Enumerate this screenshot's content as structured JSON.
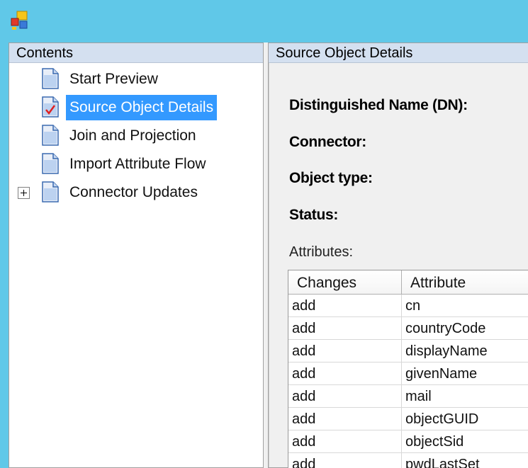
{
  "window": {
    "icon": "app-icon"
  },
  "contents_pane": {
    "header": "Contents",
    "items": [
      {
        "label": "Start Preview",
        "icon": "document-icon",
        "selected": false,
        "expandable": false
      },
      {
        "label": "Source Object Details",
        "icon": "document-check-icon",
        "selected": true,
        "expandable": false
      },
      {
        "label": "Join and Projection",
        "icon": "document-icon",
        "selected": false,
        "expandable": false
      },
      {
        "label": "Import Attribute Flow",
        "icon": "document-icon",
        "selected": false,
        "expandable": false
      },
      {
        "label": "Connector Updates",
        "icon": "document-icon",
        "selected": false,
        "expandable": true
      }
    ]
  },
  "details_pane": {
    "header": "Source Object Details",
    "dn_label": "Distinguished Name (DN):",
    "connector_label": "Connector:",
    "object_type_label": "Object type:",
    "status_label": "Status:",
    "attributes_label": "Attributes:",
    "grid": {
      "columns": [
        "Changes",
        "Attribute"
      ],
      "rows": [
        [
          "add",
          "cn"
        ],
        [
          "add",
          "countryCode"
        ],
        [
          "add",
          "displayName"
        ],
        [
          "add",
          "givenName"
        ],
        [
          "add",
          "mail"
        ],
        [
          "add",
          "objectGUID"
        ],
        [
          "add",
          "objectSid"
        ],
        [
          "add",
          "pwdLastSet"
        ]
      ]
    }
  },
  "colors": {
    "titlebar": "#60c8e8",
    "pane_header": "#d4e0f0",
    "selection": "#3399ff",
    "check_mark": "#e02020"
  }
}
